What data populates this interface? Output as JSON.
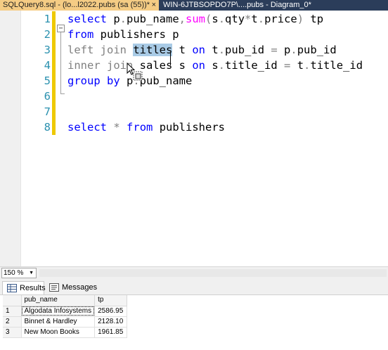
{
  "tabs": {
    "active_label": "SQLQuery8.sql - (lo...l2022.pubs (sa (55))*",
    "active_close": "×",
    "inactive_label": "WIN-6JTBSOPDO7P\\....pubs - Diagram_0*"
  },
  "editor": {
    "fold_symbol": "−",
    "lines": [
      {
        "num": "1",
        "parts": [
          {
            "t": "select",
            "c": "kw"
          },
          {
            "t": " p"
          },
          {
            "t": ".",
            "c": "op"
          },
          {
            "t": "pub_name"
          },
          {
            "t": ",",
            "c": "op"
          },
          {
            "t": "sum",
            "c": "fn"
          },
          {
            "t": "(",
            "c": "op"
          },
          {
            "t": "s"
          },
          {
            "t": ".",
            "c": "op"
          },
          {
            "t": "qty"
          },
          {
            "t": "*",
            "c": "op"
          },
          {
            "t": "t"
          },
          {
            "t": ".",
            "c": "op"
          },
          {
            "t": "price"
          },
          {
            "t": ")",
            "c": "op"
          },
          {
            "t": " tp"
          }
        ]
      },
      {
        "num": "2",
        "parts": [
          {
            "t": "from",
            "c": "kw"
          },
          {
            "t": " publishers p"
          }
        ]
      },
      {
        "num": "3",
        "parts": [
          {
            "t": "left join",
            "c": "op"
          },
          {
            "t": " "
          },
          {
            "t": "titles",
            "c": "hl"
          },
          {
            "t": " t "
          },
          {
            "t": "on",
            "c": "kw"
          },
          {
            "t": " t"
          },
          {
            "t": ".",
            "c": "op"
          },
          {
            "t": "pub_id "
          },
          {
            "t": "=",
            "c": "op"
          },
          {
            "t": " p"
          },
          {
            "t": ".",
            "c": "op"
          },
          {
            "t": "pub_id"
          }
        ]
      },
      {
        "num": "4",
        "parts": [
          {
            "t": "inner join",
            "c": "op"
          },
          {
            "t": " sales s "
          },
          {
            "t": "on",
            "c": "kw"
          },
          {
            "t": " s"
          },
          {
            "t": ".",
            "c": "op"
          },
          {
            "t": "title_id "
          },
          {
            "t": "=",
            "c": "op"
          },
          {
            "t": " t"
          },
          {
            "t": ".",
            "c": "op"
          },
          {
            "t": "title_id"
          }
        ]
      },
      {
        "num": "5",
        "parts": [
          {
            "t": "group by",
            "c": "kw"
          },
          {
            "t": " p"
          },
          {
            "t": ".",
            "c": "op"
          },
          {
            "t": "pub_name"
          }
        ]
      },
      {
        "num": "6",
        "parts": []
      },
      {
        "num": "7",
        "parts": []
      },
      {
        "num": "8",
        "parts": [
          {
            "t": "select",
            "c": "kw"
          },
          {
            "t": " "
          },
          {
            "t": "*",
            "c": "op"
          },
          {
            "t": " "
          },
          {
            "t": "from",
            "c": "kw"
          },
          {
            "t": " publishers"
          }
        ]
      }
    ]
  },
  "zoom": {
    "value": "150 %",
    "arrow": "▼"
  },
  "results_tabs": {
    "results_label": "Results",
    "messages_label": "Messages"
  },
  "grid": {
    "columns": [
      "pub_name",
      "tp"
    ],
    "rows": [
      {
        "num": "1",
        "pub_name": "Algodata Infosystems",
        "tp": "2586.95"
      },
      {
        "num": "2",
        "pub_name": "Binnet & Hardley",
        "tp": "2128.10"
      },
      {
        "num": "3",
        "pub_name": "New Moon Books",
        "tp": "1961.85"
      }
    ]
  },
  "colors": {
    "tab_active_bg": "#f5cc84",
    "tab_strip_bg": "#2b3d5a",
    "keyword": "#0000ff",
    "function": "#ff00ff",
    "operator": "#808080",
    "line_number": "#2b91af",
    "selection": "#a9cbe6",
    "change_marker": "#eec900"
  },
  "icons": [
    "close-icon",
    "fold-collapse-icon",
    "mouse-pointer-icon",
    "drag-copy-icon",
    "dropdown-arrow-icon",
    "grid-results-icon",
    "messages-icon"
  ]
}
